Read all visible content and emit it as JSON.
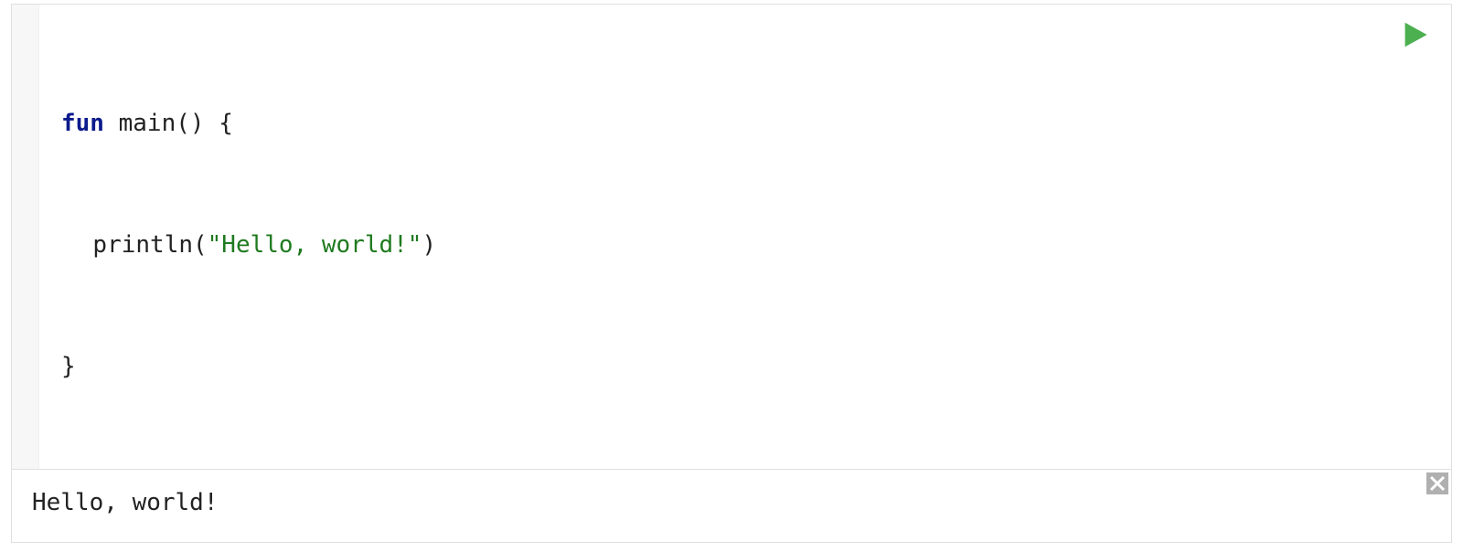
{
  "icons": {
    "run": "play-icon",
    "close": "close-icon"
  },
  "colors": {
    "keyword": "#0b1a8c",
    "string": "#1f7a1f",
    "run_fill": "#4caf50",
    "close_bg": "#b0b0b0",
    "close_x": "#ffffff"
  },
  "code": {
    "line1": {
      "keyword": "fun",
      "rest": " main() {"
    },
    "line2": {
      "call": "println(",
      "string": "\"Hello, world!\"",
      "close": ")"
    },
    "line3": {
      "text": "}"
    }
  },
  "output": {
    "text": "Hello, world!"
  }
}
